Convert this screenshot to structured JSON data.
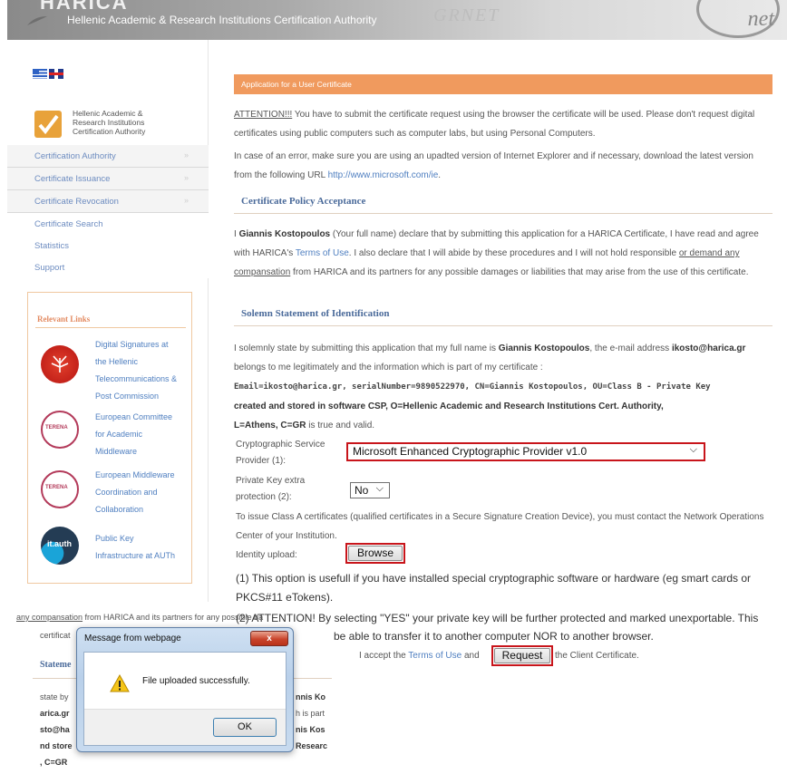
{
  "header": {
    "logo_partial": "HARICA",
    "title": "Hellenic Academic & Research Institutions Certification Authority",
    "logo_right": "net",
    "watermark": "GRNET"
  },
  "sidebar": {
    "org_name_line1": "Hellenic Academic &",
    "org_name_line2": "Research Institutions",
    "org_name_line3": "Certification Authority",
    "nav": [
      {
        "label": "Certification Authority",
        "arrow": "»"
      },
      {
        "label": "Certificate Issuance",
        "arrow": "»"
      },
      {
        "label": "Certificate Revocation",
        "arrow": "»"
      },
      {
        "label": "Certificate Search"
      },
      {
        "label": "Statistics"
      },
      {
        "label": "Support"
      }
    ],
    "links_title": "Relevant Links",
    "links": [
      {
        "line1": "Digital Signatures at",
        "line2": "the Hellenic",
        "line3": "Telecommunications &",
        "line4": "Post Commission"
      },
      {
        "line1": "European Committee",
        "line2": "for Academic",
        "line3": "Middleware",
        "icon_text": "TERENA"
      },
      {
        "line1": "European Middleware",
        "line2": "Coordination and",
        "line3": "Collaboration",
        "icon_text": "TERENA"
      },
      {
        "line1": "Public Key",
        "line2": "Infrastructure at AUTh",
        "icon_text": "it.auth"
      }
    ]
  },
  "main": {
    "app_header": "Application for a User Certificate",
    "attention": "ATTENTION!!!",
    "attention_rest": " You have to submit the certificate request using the browser the certificate will be used. Please don't request digital certificates using public computers such as computer labs, but using Personal Computers.",
    "error_text": "In case of an error, make sure you are using an upadted version of Internet Explorer and if necessary, download the latest version from the following URL ",
    "error_url": "http://www.microsoft.com/ie",
    "error_end": ".",
    "policy_heading": "Certificate Policy Acceptance",
    "policy_i": "I ",
    "policy_name": "Giannis Kostopoulos",
    "policy_text1": " (Your full name) declare that by submitting this application for a HARICA Certificate, I have read and agree with HARICA's ",
    "policy_terms": "Terms of Use",
    "policy_text2": ". I also declare that I will abide by these procedures and I will not hold responsible ",
    "policy_or": "or ",
    "policy_demand": "demand any compansation",
    "policy_text3": " from HARICA and its partners for any possible damages or liabilities that may arise from the use of this certificate.",
    "solemn_heading": "Solemn Statement of Identification",
    "solemn_text1": "I solemnly state by submitting this application that my full name is ",
    "solemn_name": "Giannis Kostopoulos",
    "solemn_text2": ", the e-mail address ",
    "solemn_email": "ikosto@harica.gr",
    "solemn_text3": " belongs to me legitimately and the information which is part of my certificate :",
    "solemn_dn": "Email=ikosto@harica.gr, serialNumber=9890522970, CN=Giannis Kostopoulos, OU=Class B - Private Key",
    "solemn_dn2": "created and stored in software CSP, O=Hellenic Academic and Research Institutions Cert. Authority,",
    "solemn_dn3": "L=Athens, C=GR",
    "solemn_end": " is true and valid.",
    "csp_label1": "Cryptographic Service",
    "csp_label2": "Provider (1):",
    "csp_value": "Microsoft Enhanced Cryptographic Provider v1.0",
    "pk_label1": "Private Key extra",
    "pk_label2": "protection (2):",
    "pk_value": "No",
    "classA": "To issue Class A certificates (qualified certificates in a Secure Signature Creation Device), you must contact the Network Operations Center of your Institution.",
    "identity_label": "Identity upload:",
    "browse_label": "Browse",
    "note1": "(1) This option is usefull if you have installed special cryptographic software or hardware (eg smart cards or PKCS#11 eTokens).",
    "note2": "(2) ATTENTION! By selecting \"YES\" your private key will be further protected and marked unexportable. This",
    "note2b": "be able to transfer it to another computer NOR to another browser.",
    "accept_pre": "I accept the ",
    "accept_terms": "Terms of Use",
    "accept_and": " and",
    "request_label": "Request",
    "accept_post": " the Client Certificate."
  },
  "ghost": {
    "line1_link": "any compansation",
    "line1_rest": " from HARICA and its partners for any possible da",
    "line2": "certificat",
    "heading": "Stateme",
    "r1a": "state by",
    "r1b": "nnis Ko",
    "r2a": "arica.gr",
    "r2b": "h is part",
    "r3a": "sto@ha",
    "r3b": "nis Kos",
    "r4a": "nd store",
    "r4b": "Researc",
    "r5a": ", C=GR"
  },
  "dialog": {
    "title": "Message from webpage",
    "close": "x",
    "message": "File uploaded successfully.",
    "ok": "OK"
  }
}
